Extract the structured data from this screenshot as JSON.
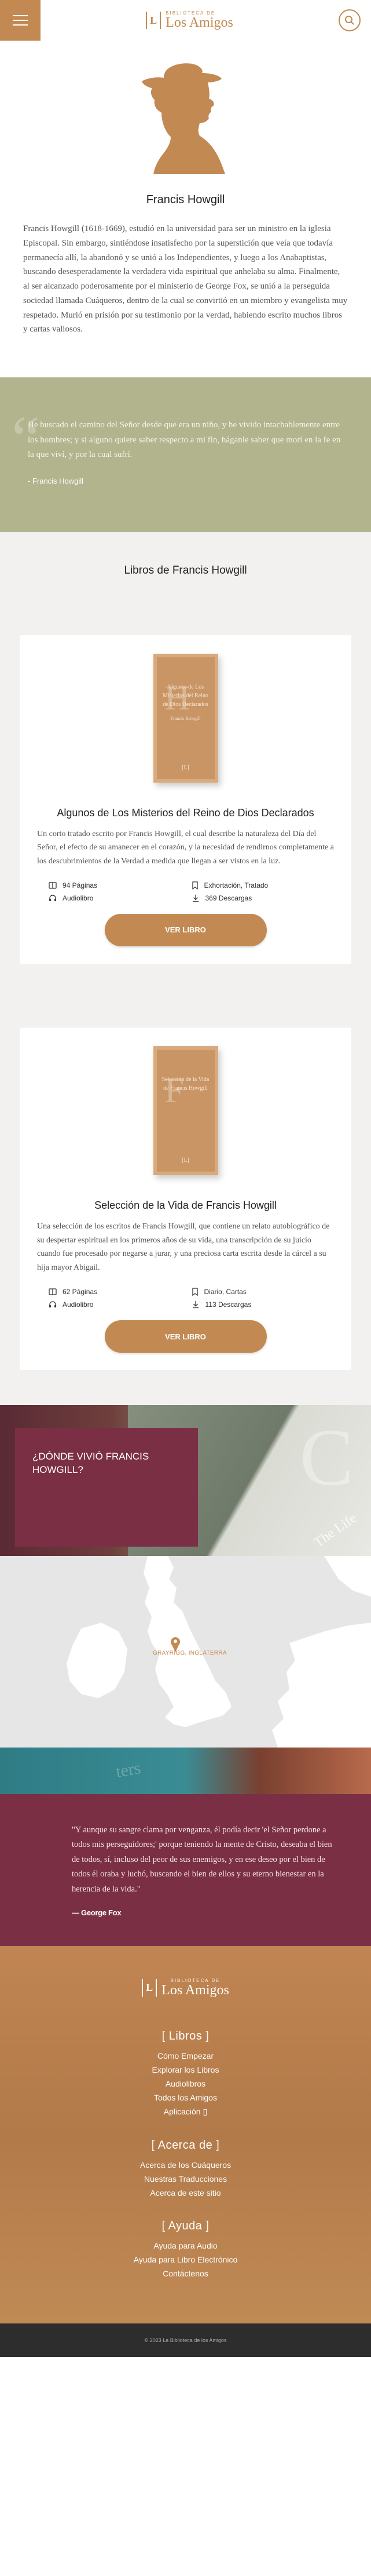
{
  "header": {
    "logo_small": "BIBLIOTECA DE",
    "logo_big": "Los Amigos",
    "logo_mark": "L"
  },
  "hero": {
    "title": "Francis Howgill",
    "bio": "Francis Howgill (1618-1669), estudió en la universidad para ser un ministro en la iglesia Episcopal. Sin embargo, sintiéndose insatisfecho por la superstición que veía que todavía permanecía allí, la abandonó y se unió a los Independientes, y luego a los Anabaptistas, buscando desesperadamente la verdadera vida espiritual que anhelaba su alma. Finalmente, al ser alcanzado poderosamente por el ministerio de George Fox, se unió a la perseguida sociedad llamada Cuáqueros, dentro de la cual se convirtió en un miembro y evangelista muy respetado. Murió en prisión por su testimonio por la verdad, habiendo escrito muchos libros y cartas valiosos."
  },
  "quote1": {
    "text": "He buscado el camino del Señor desde que era un niño, y he vivido intachablemente entre los hombres; y si alguno quiere saber respecto a mi fin, háganle saber que morí en la fe en la que viví, y por la cual sufrí.",
    "author": "- Francis Howgill"
  },
  "books": {
    "heading": "Libros de Francis Howgill",
    "items": [
      {
        "cover_initial": "H",
        "cover_title": "Algunos de Los Misterios del Reino de Dios Declarados",
        "cover_author": "Francis Howgill",
        "title": "Algunos de Los Misterios del Reino de Dios Declarados",
        "description": "Un corto tratado escrito por Francis Howgill, el cual describe la naturaleza del Día del Señor, el efecto de su amanecer en el corazón, y la necesidad de rendirnos completamente a los descubrimientos de la Verdad a medida que llegan a ser vistos en la luz.",
        "pages": "94 Páginas",
        "category": "Exhortación, Tratado",
        "audio": "Audiolibro",
        "downloads": "369 Descargas",
        "button": "VER LIBRO"
      },
      {
        "cover_initial": "F",
        "cover_title": "Selección de la Vida de Francis Howgill",
        "cover_author": "",
        "title": "Selección de la Vida de Francis Howgill",
        "description": "Una selección de los escritos de Francis Howgill, que contiene un relato autobiográfico de su despertar espiritual en los primeros años de su vida, una transcripción de su juicio cuando fue procesado por negarse a jurar, y una preciosa carta escrita desde la cárcel a su hija mayor Abigail.",
        "pages": "62 Páginas",
        "category": "Diario, Cartas",
        "audio": "Audiolibro",
        "downloads": "113 Descargas",
        "button": "VER LIBRO"
      }
    ]
  },
  "where": {
    "heading": "¿DÓNDE VIVIÓ FRANCIS HOWGILL?",
    "deco_letter": "C",
    "deco_text": "The Life",
    "map_label": "GRAYRIGG, INGLATERRA"
  },
  "teal_deco": "ters",
  "quote2": {
    "text": "\"Y aunque su sangre clama por venganza, él podía decir 'el Señor perdone a todos mis perseguidores;' porque teniendo la mente de Cristo, deseaba el bien de todos, sí, incluso del peor de sus enemigos, y en ese deseo por el bien de todos él oraba y luchó, buscando el bien de ellos y su eterno bienestar en la herencia de la vida.\"",
    "author": "— George Fox"
  },
  "footer": {
    "logo_small": "BIBLIOTECA DE",
    "logo_big": "Los Amigos",
    "groups": [
      {
        "heading": "Libros",
        "links": [
          "Cómo Empezar",
          "Explorar los Libros",
          "Audiolibros",
          "Todos los Amigos",
          "Aplicación"
        ]
      },
      {
        "heading": "Acerca de",
        "links": [
          "Acerca de los Cuáqueros",
          "Nuestras Traducciones",
          "Acerca de este sitio"
        ]
      },
      {
        "heading": "Ayuda",
        "links": [
          "Ayuda para Audio",
          "Ayuda para Libro Electrónico",
          "Contáctenos"
        ]
      }
    ],
    "copyright": "© 2023 La Biblioteca de los Amigos"
  },
  "colors": {
    "accent": "#c28a52",
    "olive": "#b2b48d",
    "maroon": "#7b2f45"
  }
}
